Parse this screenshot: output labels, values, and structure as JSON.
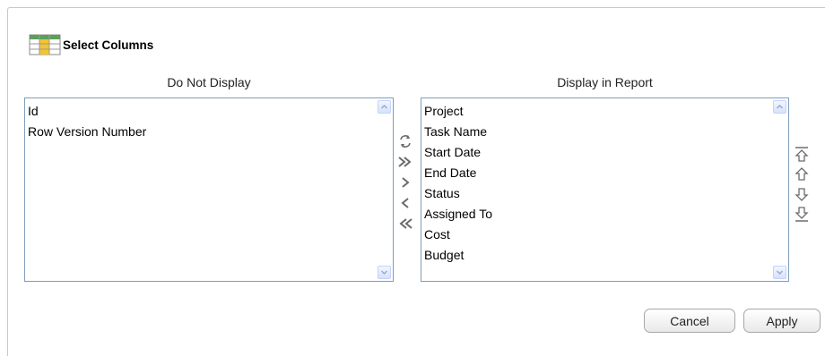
{
  "dialog": {
    "title": "Select Columns"
  },
  "left_list": {
    "header": "Do Not Display",
    "items": [
      "Id",
      "Row Version Number"
    ]
  },
  "right_list": {
    "header": "Display in Report",
    "items": [
      "Project",
      "Task Name",
      "Start Date",
      "End Date",
      "Status",
      "Assigned To",
      "Cost",
      "Budget"
    ]
  },
  "move_controls": [
    "reset-icon",
    "move-all-right-icon",
    "move-right-icon",
    "move-left-icon",
    "move-all-left-icon"
  ],
  "order_controls": [
    "move-top-icon",
    "move-up-icon",
    "move-down-icon",
    "move-bottom-icon"
  ],
  "buttons": {
    "cancel": "Cancel",
    "apply": "Apply"
  },
  "colors": {
    "list_border": "#7f9db9",
    "scroll_arrow": "#4d6185",
    "control_icon": "#6b6b6b"
  }
}
